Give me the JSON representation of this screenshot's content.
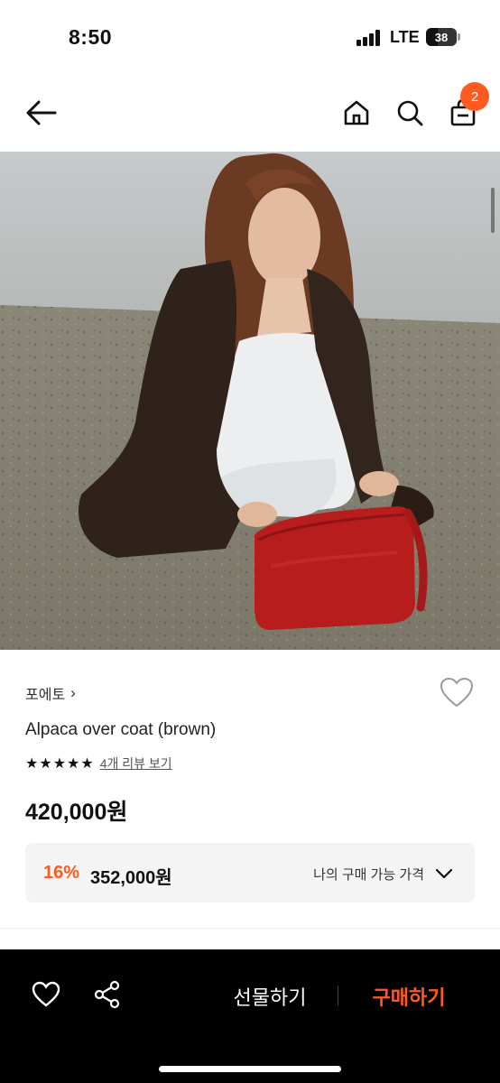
{
  "status_bar": {
    "time": "8:50",
    "network": "LTE",
    "battery": "38",
    "battery_level_percent": 38
  },
  "nav": {
    "back_icon": "arrow-left-icon",
    "home_icon": "home-icon",
    "search_icon": "search-icon",
    "cart_icon": "shopping-bag-icon",
    "cart_count": "2"
  },
  "product": {
    "brand": "포에토",
    "brand_chevron": "›",
    "name": "Alpaca over coat (brown)",
    "rating_stars": "★★★★★",
    "rating_value": 5,
    "review_link": "4개 리뷰 보기",
    "price": "420,000원",
    "discount": {
      "rate": "16%",
      "price": "352,000원",
      "label": "나의 구매 가능 가격"
    }
  },
  "bottom_bar": {
    "wishlist_icon": "heart-icon",
    "share_icon": "share-icon",
    "gift_label": "선물하기",
    "buy_label": "구매하기"
  },
  "colors": {
    "accent": "#ff5a1f",
    "text": "#111111",
    "bottom_bar_bg": "#000000",
    "discount_box_bg": "#f4f4f5"
  }
}
